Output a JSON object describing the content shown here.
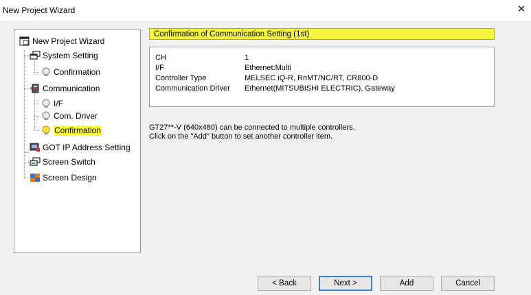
{
  "window": {
    "title": "New Project Wizard",
    "close_glyph": "✕"
  },
  "tree": {
    "root": "New Project Wizard",
    "system_setting": "System Setting",
    "system_confirmation": "Confirmation",
    "communication": "Communication",
    "if": "I/F",
    "com_driver": "Com. Driver",
    "comm_confirmation": "Confirmation",
    "got_ip": "GOT IP Address Setting",
    "screen_switch": "Screen Switch",
    "screen_design": "Screen Design",
    "selected_item": "comm_confirmation"
  },
  "main": {
    "header": "Confirmation of Communication Setting (1st)",
    "rows": [
      {
        "key": "CH",
        "value": "1"
      },
      {
        "key": "I/F",
        "value": "Ethernet:Multi"
      },
      {
        "key": "Controller Type",
        "value": "MELSEC iQ-R, RnMT/NC/RT, CR800-D"
      },
      {
        "key": "Communication Driver",
        "value": "Ethernet(MITSUBISHI ELECTRIC), Gateway"
      }
    ],
    "message_line1": "GT27**-V (640x480) can be connected to multiple controllers.",
    "message_line2": "Click on the \"Add\" button to set another controller item."
  },
  "buttons": {
    "back": "< Back",
    "next": "Next >",
    "add": "Add",
    "cancel": "Cancel"
  },
  "icons": {
    "root": "wizard-window-icon",
    "system_setting": "system-setting-icon",
    "confirmation": "lightbulb-icon",
    "communication": "communication-icon",
    "got_ip": "ip-address-icon",
    "screen_switch": "screen-switch-icon",
    "screen_design": "screen-design-icon"
  },
  "colors": {
    "highlight": "#ffff33",
    "header_bg": "#f5f53c",
    "default_button_border": "#3c7fd1"
  }
}
